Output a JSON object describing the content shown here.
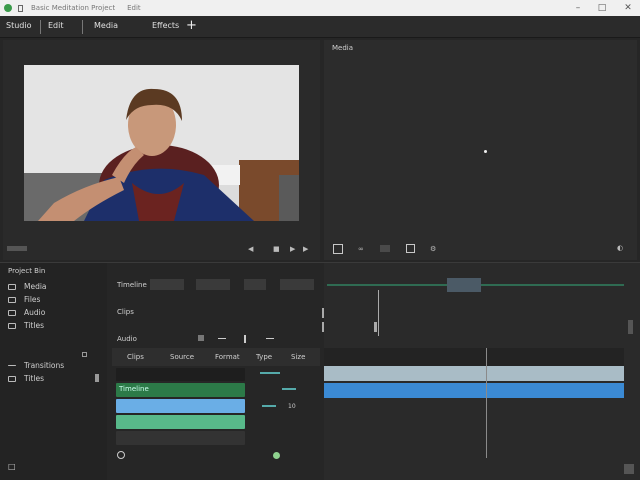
{
  "window": {
    "title": "Basic Meditation Project",
    "subtitle": "Edit"
  },
  "menu": {
    "items": [
      "Studio",
      "Edit",
      "Media",
      "Effects"
    ]
  },
  "preview": {
    "label": "Media"
  },
  "project_panel": {
    "title": "Project Bin",
    "items": [
      "Media",
      "Files",
      "Audio",
      "Titles"
    ],
    "extra_items": [
      "Transitions",
      "Titles"
    ]
  },
  "timeline": {
    "title": "Timeline",
    "label2": "Clips",
    "label3": "Audio",
    "track_time": "10",
    "headers": [
      "Clips",
      "Source",
      "Format",
      "Type",
      "Size"
    ],
    "green_track_label": "Timeline"
  },
  "colors": {
    "accent_green": "#2c7a48",
    "clip_blue": "#6aaee6",
    "clip_green": "#58b98a",
    "timeline_blue": "#3b8ad4",
    "timeline_silver": "#a9bcc6"
  }
}
